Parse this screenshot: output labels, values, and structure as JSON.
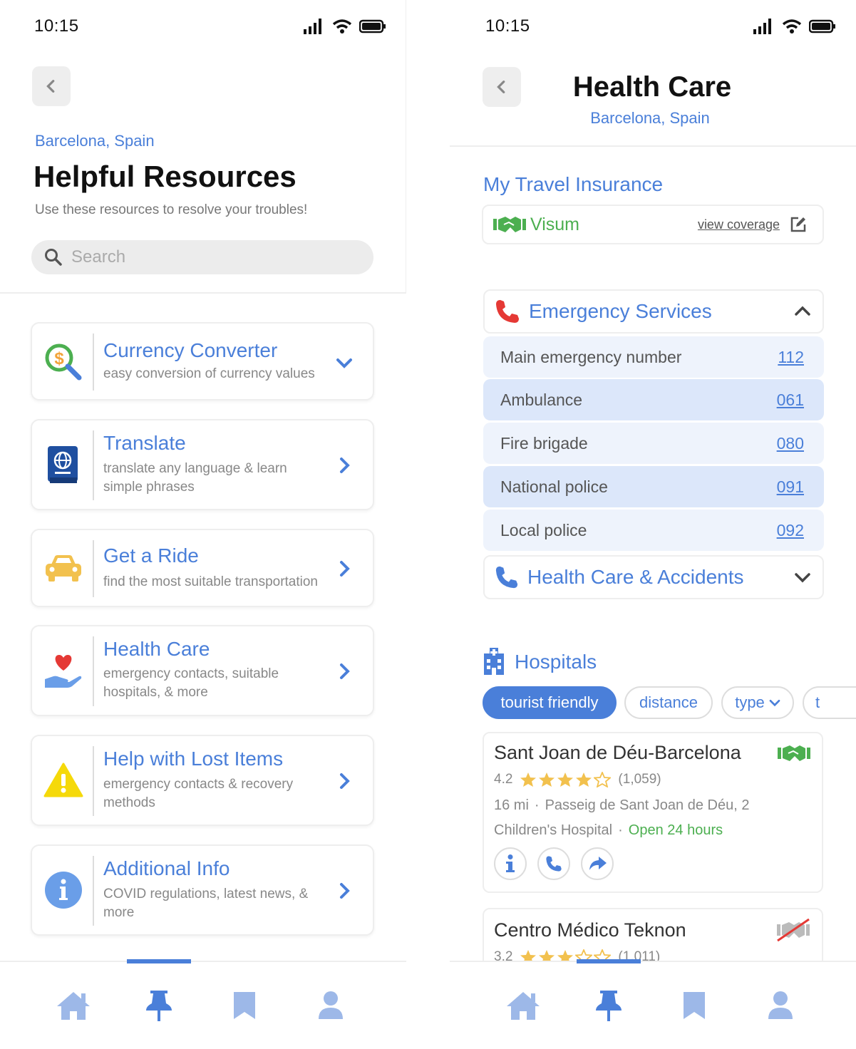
{
  "status": {
    "time": "10:15"
  },
  "left": {
    "location": "Barcelona, Spain",
    "title": "Helpful Resources",
    "subtitle": "Use these resources to resolve your troubles!",
    "search_placeholder": "Search",
    "cards": [
      {
        "title": "Currency Converter",
        "desc": "easy conversion of currency values",
        "icon": "currency-search-icon",
        "chevron": "down"
      },
      {
        "title": "Translate",
        "desc": "translate any language & learn simple phrases",
        "icon": "passport-globe-icon",
        "chevron": "right"
      },
      {
        "title": "Get a Ride",
        "desc": "find the most suitable transportation",
        "icon": "car-icon",
        "chevron": "right"
      },
      {
        "title": "Health Care",
        "desc": "emergency contacts, suitable hospitals, & more",
        "icon": "heart-hand-icon",
        "chevron": "right"
      },
      {
        "title": "Help with Lost Items",
        "desc": "emergency contacts & recovery methods",
        "icon": "warning-icon",
        "chevron": "right"
      },
      {
        "title": "Additional Info",
        "desc": "COVID regulations, latest news, & more",
        "icon": "info-icon",
        "chevron": "right"
      }
    ],
    "active_tab": "pin"
  },
  "right": {
    "title": "Health Care",
    "location": "Barcelona, Spain",
    "insurance_heading": "My Travel Insurance",
    "insurance_name": "Visum",
    "view_coverage": "view coverage",
    "emergency_heading": "Emergency Services",
    "emergency_rows": [
      {
        "label": "Main emergency number",
        "number": "112"
      },
      {
        "label": "Ambulance",
        "number": "061"
      },
      {
        "label": "Fire brigade",
        "number": "080"
      },
      {
        "label": "National police",
        "number": "091"
      },
      {
        "label": "Local police",
        "number": "092"
      }
    ],
    "health_accidents_heading": "Health Care & Accidents",
    "hospitals_heading": "Hospitals",
    "filters": {
      "tourist": "tourist friendly",
      "distance": "distance",
      "type": "type",
      "more": "t"
    },
    "hospital1": {
      "name": "Sant Joan de Déu-Barcelona",
      "rating": "4.2",
      "reviews": "(1,059)",
      "distance": "16 mi",
      "address": "Passeig de Sant Joan de Déu, 2",
      "kind": "Children's Hospital",
      "hours": "Open 24 hours"
    },
    "hospital2": {
      "name": "Centro Médico Teknon",
      "rating": "3.2",
      "reviews": "(1,011)"
    },
    "dot": "·",
    "active_tab": "pin"
  },
  "colors": {
    "accent": "#4a7fd9",
    "green": "#4caf50",
    "red": "#e53935",
    "yellow": "#f2c14e"
  }
}
